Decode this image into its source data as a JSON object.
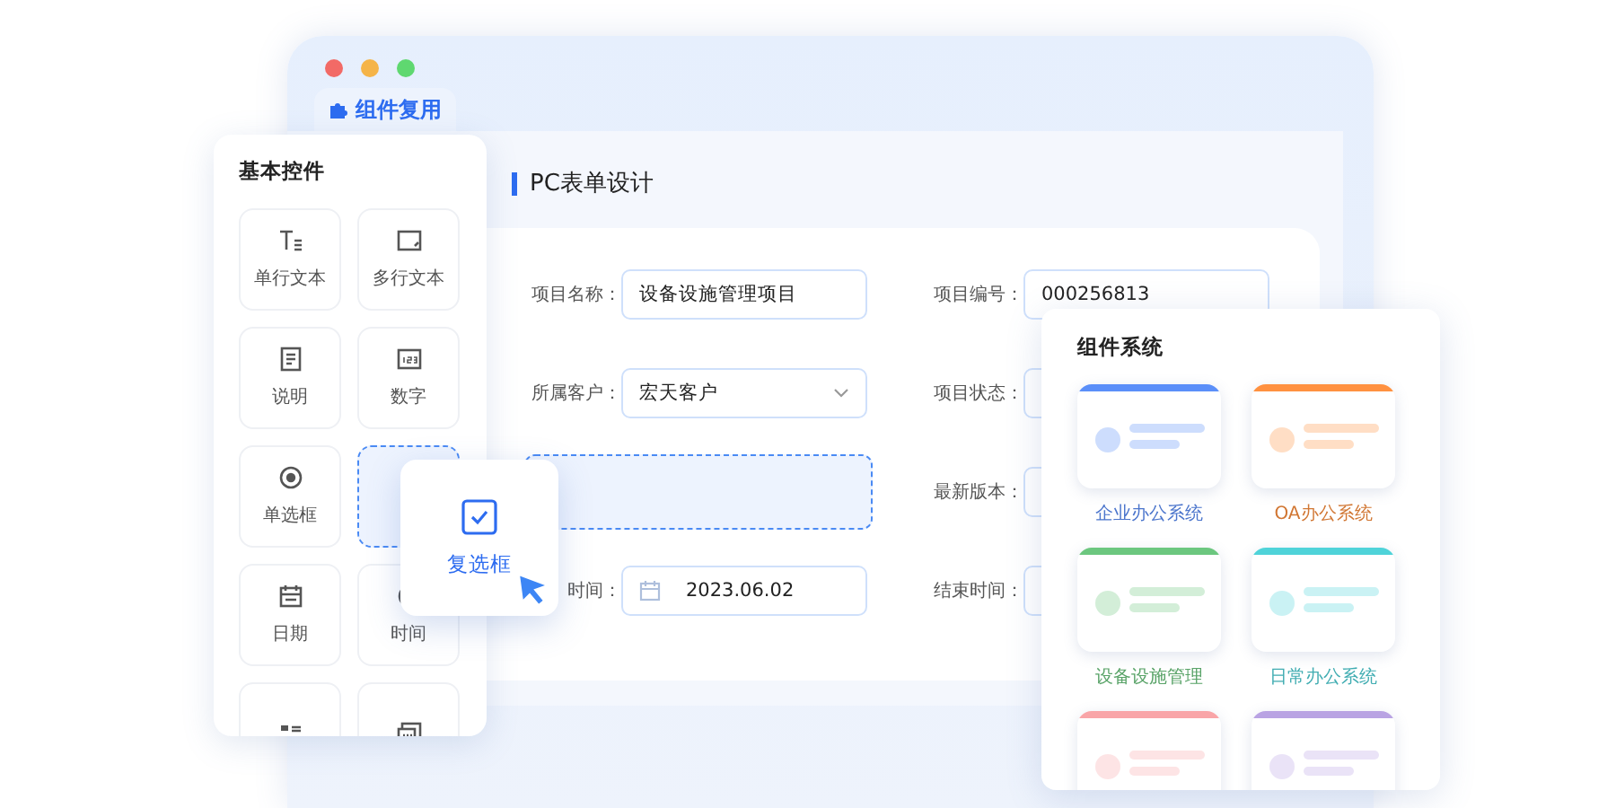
{
  "window": {
    "tab": "组件复用"
  },
  "form": {
    "title": "PC表单设计",
    "fields": [
      {
        "kind": "text",
        "label": "项目名称：",
        "value": "设备设施管理项目"
      },
      {
        "kind": "text",
        "label": "项目编号：",
        "value": "000256813"
      },
      {
        "kind": "select",
        "label": "所属客户：",
        "value": "宏天客户"
      },
      {
        "kind": "text",
        "label": "项目状态："
      },
      {
        "kind": "dropzone"
      },
      {
        "kind": "text",
        "label": "最新版本："
      },
      {
        "kind": "date",
        "label": "时间：",
        "value": "2023.06.02"
      },
      {
        "kind": "text",
        "label": "结束时间："
      }
    ]
  },
  "palette": {
    "title": "基本控件",
    "items": [
      {
        "kind": "tile",
        "label": "单行文本"
      },
      {
        "kind": "tile",
        "label": "多行文本"
      },
      {
        "kind": "tile",
        "label": "说明"
      },
      {
        "kind": "tile",
        "label": "数字"
      },
      {
        "kind": "tile",
        "label": "单选框"
      },
      {
        "kind": "placeholder"
      },
      {
        "kind": "tile",
        "label": "日期"
      },
      {
        "kind": "tile",
        "label": "时间"
      },
      {
        "kind": "tile"
      },
      {
        "kind": "tile"
      }
    ]
  },
  "drag_card": {
    "label": "复选框"
  },
  "systems": {
    "title": "组件系统",
    "items": [
      {
        "label": "企业办公系统",
        "color": "#5b8ff9"
      },
      {
        "label": "OA办公系统",
        "color": "#ff9140"
      },
      {
        "label": "设备设施管理",
        "color": "#6cc77f"
      },
      {
        "label": "日常办公系统",
        "color": "#4fd3d9"
      },
      {
        "color": "#f9a5a8"
      },
      {
        "color": "#b9a3e3"
      }
    ]
  }
}
